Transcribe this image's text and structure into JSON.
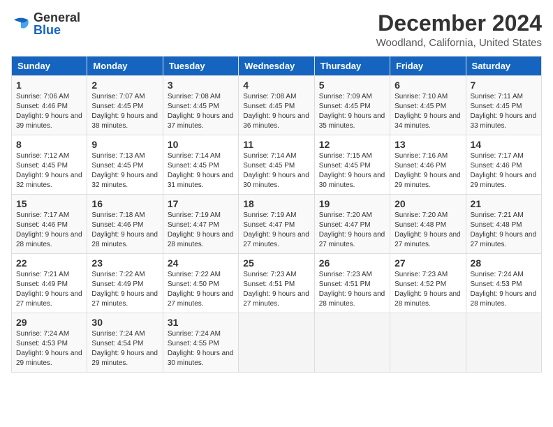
{
  "logo": {
    "general": "General",
    "blue": "Blue"
  },
  "title": "December 2024",
  "subtitle": "Woodland, California, United States",
  "days_of_week": [
    "Sunday",
    "Monday",
    "Tuesday",
    "Wednesday",
    "Thursday",
    "Friday",
    "Saturday"
  ],
  "weeks": [
    [
      {
        "day": "1",
        "sunrise": "7:06 AM",
        "sunset": "4:46 PM",
        "daylight": "9 hours and 39 minutes."
      },
      {
        "day": "2",
        "sunrise": "7:07 AM",
        "sunset": "4:45 PM",
        "daylight": "9 hours and 38 minutes."
      },
      {
        "day": "3",
        "sunrise": "7:08 AM",
        "sunset": "4:45 PM",
        "daylight": "9 hours and 37 minutes."
      },
      {
        "day": "4",
        "sunrise": "7:08 AM",
        "sunset": "4:45 PM",
        "daylight": "9 hours and 36 minutes."
      },
      {
        "day": "5",
        "sunrise": "7:09 AM",
        "sunset": "4:45 PM",
        "daylight": "9 hours and 35 minutes."
      },
      {
        "day": "6",
        "sunrise": "7:10 AM",
        "sunset": "4:45 PM",
        "daylight": "9 hours and 34 minutes."
      },
      {
        "day": "7",
        "sunrise": "7:11 AM",
        "sunset": "4:45 PM",
        "daylight": "9 hours and 33 minutes."
      }
    ],
    [
      {
        "day": "8",
        "sunrise": "7:12 AM",
        "sunset": "4:45 PM",
        "daylight": "9 hours and 32 minutes."
      },
      {
        "day": "9",
        "sunrise": "7:13 AM",
        "sunset": "4:45 PM",
        "daylight": "9 hours and 32 minutes."
      },
      {
        "day": "10",
        "sunrise": "7:14 AM",
        "sunset": "4:45 PM",
        "daylight": "9 hours and 31 minutes."
      },
      {
        "day": "11",
        "sunrise": "7:14 AM",
        "sunset": "4:45 PM",
        "daylight": "9 hours and 30 minutes."
      },
      {
        "day": "12",
        "sunrise": "7:15 AM",
        "sunset": "4:45 PM",
        "daylight": "9 hours and 30 minutes."
      },
      {
        "day": "13",
        "sunrise": "7:16 AM",
        "sunset": "4:46 PM",
        "daylight": "9 hours and 29 minutes."
      },
      {
        "day": "14",
        "sunrise": "7:17 AM",
        "sunset": "4:46 PM",
        "daylight": "9 hours and 29 minutes."
      }
    ],
    [
      {
        "day": "15",
        "sunrise": "7:17 AM",
        "sunset": "4:46 PM",
        "daylight": "9 hours and 28 minutes."
      },
      {
        "day": "16",
        "sunrise": "7:18 AM",
        "sunset": "4:46 PM",
        "daylight": "9 hours and 28 minutes."
      },
      {
        "day": "17",
        "sunrise": "7:19 AM",
        "sunset": "4:47 PM",
        "daylight": "9 hours and 28 minutes."
      },
      {
        "day": "18",
        "sunrise": "7:19 AM",
        "sunset": "4:47 PM",
        "daylight": "9 hours and 27 minutes."
      },
      {
        "day": "19",
        "sunrise": "7:20 AM",
        "sunset": "4:47 PM",
        "daylight": "9 hours and 27 minutes."
      },
      {
        "day": "20",
        "sunrise": "7:20 AM",
        "sunset": "4:48 PM",
        "daylight": "9 hours and 27 minutes."
      },
      {
        "day": "21",
        "sunrise": "7:21 AM",
        "sunset": "4:48 PM",
        "daylight": "9 hours and 27 minutes."
      }
    ],
    [
      {
        "day": "22",
        "sunrise": "7:21 AM",
        "sunset": "4:49 PM",
        "daylight": "9 hours and 27 minutes."
      },
      {
        "day": "23",
        "sunrise": "7:22 AM",
        "sunset": "4:49 PM",
        "daylight": "9 hours and 27 minutes."
      },
      {
        "day": "24",
        "sunrise": "7:22 AM",
        "sunset": "4:50 PM",
        "daylight": "9 hours and 27 minutes."
      },
      {
        "day": "25",
        "sunrise": "7:23 AM",
        "sunset": "4:51 PM",
        "daylight": "9 hours and 27 minutes."
      },
      {
        "day": "26",
        "sunrise": "7:23 AM",
        "sunset": "4:51 PM",
        "daylight": "9 hours and 28 minutes."
      },
      {
        "day": "27",
        "sunrise": "7:23 AM",
        "sunset": "4:52 PM",
        "daylight": "9 hours and 28 minutes."
      },
      {
        "day": "28",
        "sunrise": "7:24 AM",
        "sunset": "4:53 PM",
        "daylight": "9 hours and 28 minutes."
      }
    ],
    [
      {
        "day": "29",
        "sunrise": "7:24 AM",
        "sunset": "4:53 PM",
        "daylight": "9 hours and 29 minutes."
      },
      {
        "day": "30",
        "sunrise": "7:24 AM",
        "sunset": "4:54 PM",
        "daylight": "9 hours and 29 minutes."
      },
      {
        "day": "31",
        "sunrise": "7:24 AM",
        "sunset": "4:55 PM",
        "daylight": "9 hours and 30 minutes."
      },
      null,
      null,
      null,
      null
    ]
  ],
  "labels": {
    "sunrise": "Sunrise:",
    "sunset": "Sunset:",
    "daylight": "Daylight:"
  }
}
